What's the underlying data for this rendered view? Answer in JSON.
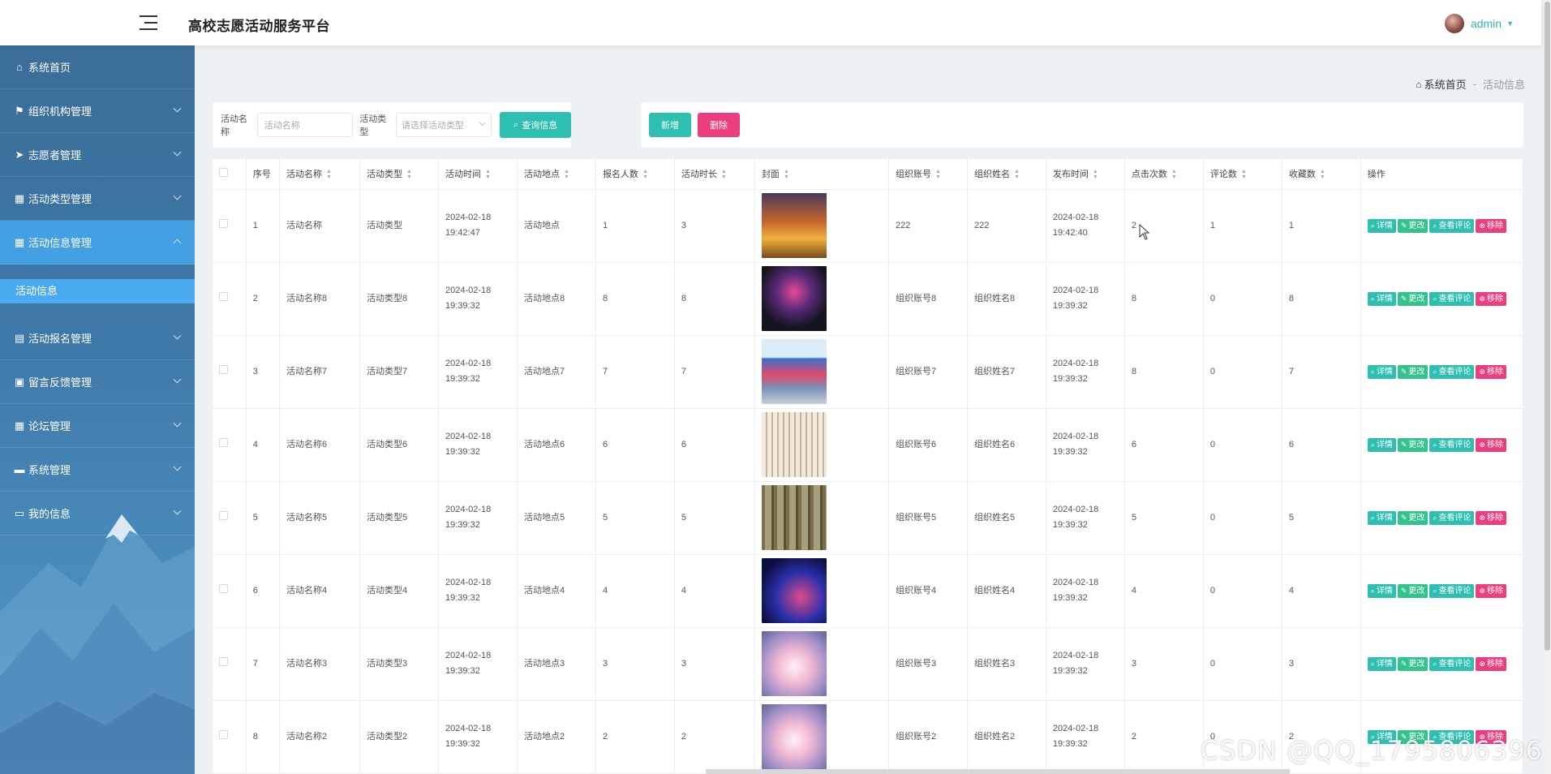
{
  "header": {
    "title": "高校志愿活动服务平台",
    "user": "admin"
  },
  "sidebar": {
    "items": [
      {
        "label": "系统首页",
        "icon": "home-icon"
      },
      {
        "label": "组织机构管理",
        "icon": "flag-icon"
      },
      {
        "label": "志愿者管理",
        "icon": "send-icon"
      },
      {
        "label": "活动类型管理",
        "icon": "grid-icon"
      },
      {
        "label": "活动信息管理",
        "icon": "grid-icon",
        "open": true
      },
      {
        "label": "活动报名管理",
        "icon": "briefcase-icon"
      },
      {
        "label": "留言反馈管理",
        "icon": "clipboard-icon"
      },
      {
        "label": "论坛管理",
        "icon": "grid-icon"
      },
      {
        "label": "系统管理",
        "icon": "chat-icon"
      },
      {
        "label": "我的信息",
        "icon": "card-icon"
      }
    ],
    "submenu": "活动信息"
  },
  "breadcrumb": {
    "home": "系统首页",
    "sep": "-",
    "current": "活动信息"
  },
  "search": {
    "name_label": "活动名称",
    "name_placeholder": "活动名称",
    "type_label": "活动类型",
    "type_placeholder": "请选择活动类型",
    "query_button": "查询信息"
  },
  "actions": {
    "add": "新增",
    "delete": "删除"
  },
  "table": {
    "headers": [
      "序号",
      "活动名称",
      "活动类型",
      "活动时间",
      "活动地点",
      "报名人数",
      "活动时长",
      "封面",
      "组织账号",
      "组织姓名",
      "发布时间",
      "点击次数",
      "评论数",
      "收藏数",
      "操作"
    ],
    "ops": {
      "detail": "详情",
      "edit": "更改",
      "review": "查看评论",
      "remove": "移除"
    },
    "rows": [
      {
        "no": "1",
        "name": "活动名称",
        "type": "活动类型",
        "time": "2024-02-18 19:42:47",
        "place": "活动地点",
        "signup": "1",
        "duration": "3",
        "cover": "sunset",
        "account": "222",
        "org": "222",
        "publish": "2024-02-18 19:42:40",
        "clicks": "2",
        "comments": "1",
        "favs": "1"
      },
      {
        "no": "2",
        "name": "活动名称8",
        "type": "活动类型8",
        "time": "2024-02-18 19:39:32",
        "place": "活动地点8",
        "signup": "8",
        "duration": "8",
        "cover": "stage",
        "account": "组织账号8",
        "org": "组织姓名8",
        "publish": "2024-02-18 19:39:32",
        "clicks": "8",
        "comments": "0",
        "favs": "8"
      },
      {
        "no": "3",
        "name": "活动名称7",
        "type": "活动类型7",
        "time": "2024-02-18 19:39:32",
        "place": "活动地点7",
        "signup": "7",
        "duration": "7",
        "cover": "outdoor-stage",
        "account": "组织账号7",
        "org": "组织姓名7",
        "publish": "2024-02-18 19:39:32",
        "clicks": "8",
        "comments": "0",
        "favs": "7"
      },
      {
        "no": "4",
        "name": "活动名称6",
        "type": "活动类型6",
        "time": "2024-02-18 19:39:32",
        "place": "活动地点6",
        "signup": "6",
        "duration": "6",
        "cover": "banquet",
        "account": "组织账号6",
        "org": "组织姓名6",
        "publish": "2024-02-18 19:39:32",
        "clicks": "6",
        "comments": "0",
        "favs": "6"
      },
      {
        "no": "5",
        "name": "活动名称5",
        "type": "活动类型5",
        "time": "2024-02-18 19:39:32",
        "place": "活动地点5",
        "signup": "5",
        "duration": "5",
        "cover": "forest",
        "account": "组织账号5",
        "org": "组织姓名5",
        "publish": "2024-02-18 19:39:32",
        "clicks": "5",
        "comments": "0",
        "favs": "5"
      },
      {
        "no": "6",
        "name": "活动名称4",
        "type": "活动类型4",
        "time": "2024-02-18 19:39:32",
        "place": "活动地点4",
        "signup": "4",
        "duration": "4",
        "cover": "concert",
        "account": "组织账号4",
        "org": "组织姓名4",
        "publish": "2024-02-18 19:39:32",
        "clicks": "4",
        "comments": "0",
        "favs": "4"
      },
      {
        "no": "7",
        "name": "活动名称3",
        "type": "活动类型3",
        "time": "2024-02-18 19:39:32",
        "place": "活动地点3",
        "signup": "3",
        "duration": "3",
        "cover": "wedding",
        "account": "组织账号3",
        "org": "组织姓名3",
        "publish": "2024-02-18 19:39:32",
        "clicks": "3",
        "comments": "0",
        "favs": "3"
      },
      {
        "no": "8",
        "name": "活动名称2",
        "type": "活动类型2",
        "time": "2024-02-18 19:39:32",
        "place": "活动地点2",
        "signup": "2",
        "duration": "2",
        "cover": "wedding",
        "account": "组织账号2",
        "org": "组织姓名2",
        "publish": "2024-02-18 19:39:32",
        "clicks": "2",
        "comments": "0",
        "favs": "2"
      }
    ]
  },
  "watermark": "CSDN @QQ_1795806396"
}
